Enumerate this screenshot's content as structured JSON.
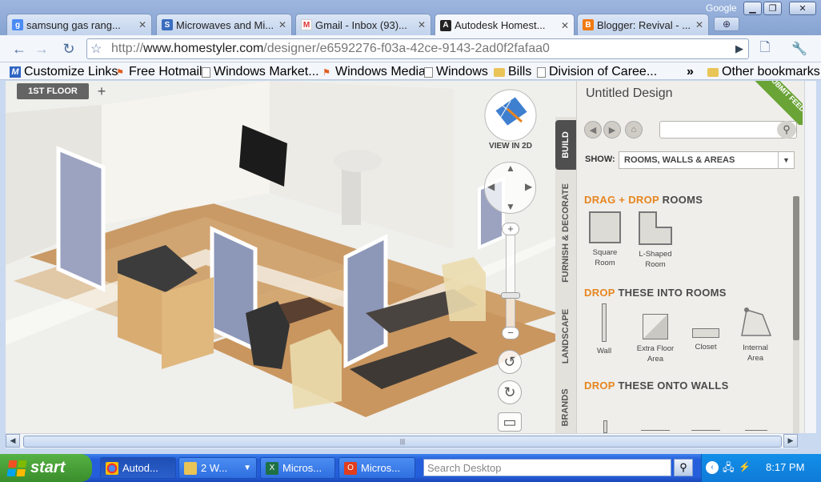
{
  "browser": {
    "window_label": "Google",
    "tabs": [
      {
        "title": "samsung gas rang...",
        "icon": "google-icon"
      },
      {
        "title": "Microwaves and Mi...",
        "icon": "s-icon"
      },
      {
        "title": "Gmail - Inbox (93)...",
        "icon": "gmail-icon"
      },
      {
        "title": "Autodesk Homest...",
        "icon": "autodesk-icon"
      },
      {
        "title": "Blogger: Revival - ...",
        "icon": "blogger-icon"
      }
    ],
    "url_prefix": "http://",
    "url_host": "www.homestyler.com",
    "url_path": "/designer/e6592276-f03a-42ce-9143-2ad0f2fafaa0",
    "bookmarks": [
      "Customize Links",
      "Free Hotmail",
      "Windows Market...",
      "Windows Media",
      "Windows",
      "Bills",
      "Division of Caree..."
    ],
    "bookmarks_more": "»",
    "other_bookmarks": "Other bookmarks"
  },
  "designer": {
    "floor_tab": "1ST FLOOR",
    "add_floor": "+",
    "view_2d_label": "VIEW IN 2D",
    "design_title": "Untitled Design",
    "feedback_label": "SUBMIT FEEDBACK",
    "vertical_tabs": [
      "BUILD",
      "FURNISH & DECORATE",
      "LANDSCAPE",
      "BRANDS"
    ],
    "show_label": "SHOW:",
    "show_value": "ROOMS, WALLS & AREAS",
    "sections": [
      {
        "highlight": "DRAG + DROP",
        "rest": " ROOMS",
        "items": [
          {
            "line1": "Square",
            "line2": "Room"
          },
          {
            "line1": "L-Shaped",
            "line2": "Room"
          }
        ]
      },
      {
        "highlight": "DROP",
        "rest": " THESE INTO ROOMS",
        "items": [
          {
            "line1": "Wall",
            "line2": ""
          },
          {
            "line1": "Extra Floor",
            "line2": "Area"
          },
          {
            "line1": "Closet",
            "line2": ""
          },
          {
            "line1": "Internal",
            "line2": "Area"
          }
        ]
      },
      {
        "highlight": "DROP",
        "rest": " THESE ONTO WALLS",
        "items": []
      }
    ]
  },
  "taskbar": {
    "start_label": "start",
    "tasks": [
      {
        "label": "Autod...",
        "icon": "chrome-icon"
      },
      {
        "label": "2 W...",
        "icon": "folder-icon"
      },
      {
        "label": "Micros...",
        "icon": "excel-icon"
      },
      {
        "label": "Micros...",
        "icon": "office-icon"
      }
    ],
    "search_placeholder": "Search Desktop",
    "clock": "8:17 PM"
  },
  "colors": {
    "accent_orange": "#e7851f",
    "feedback_green": "#6aa336",
    "taskbar_blue": "#245edb",
    "start_green": "#3a8d2c"
  }
}
